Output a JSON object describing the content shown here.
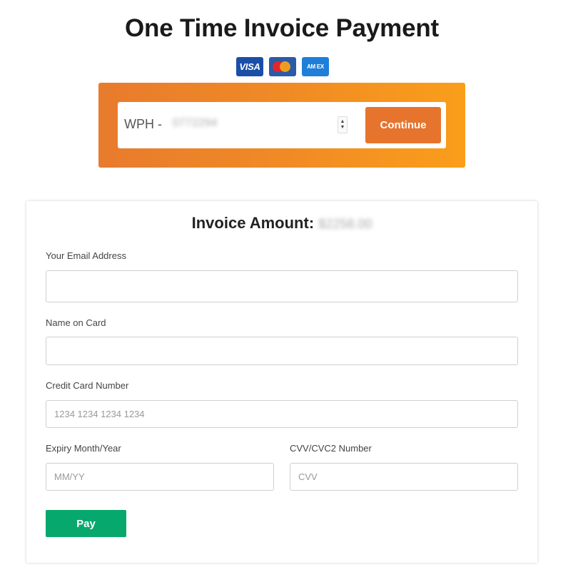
{
  "page": {
    "title": "One Time Invoice Payment"
  },
  "card_logos": {
    "visa": "VISA",
    "amex": "AM EX",
    "mastercard_icon": "mastercard-icon"
  },
  "invoice_lookup": {
    "prefix": "WPH -",
    "invoice_number": "0772294",
    "continue_label": "Continue",
    "spinner_up": "▲",
    "spinner_down": "▼"
  },
  "form": {
    "amount_label": "Invoice Amount:",
    "amount_value": "$2258.00",
    "email": {
      "label": "Your Email Address",
      "value": "",
      "placeholder": ""
    },
    "name_on_card": {
      "label": "Name on Card",
      "value": "",
      "placeholder": ""
    },
    "card_number": {
      "label": "Credit Card Number",
      "value": "",
      "placeholder": "1234 1234 1234 1234"
    },
    "expiry": {
      "label": "Expiry Month/Year",
      "value": "",
      "placeholder": "MM/YY"
    },
    "cvv": {
      "label": "CVV/CVC2 Number",
      "value": "",
      "placeholder": "CVV"
    },
    "pay_label": "Pay"
  },
  "colors": {
    "banner_start": "#e87b2d",
    "banner_end": "#fa9e1a",
    "continue_button": "#e6742c",
    "pay_button": "#07a86d"
  }
}
